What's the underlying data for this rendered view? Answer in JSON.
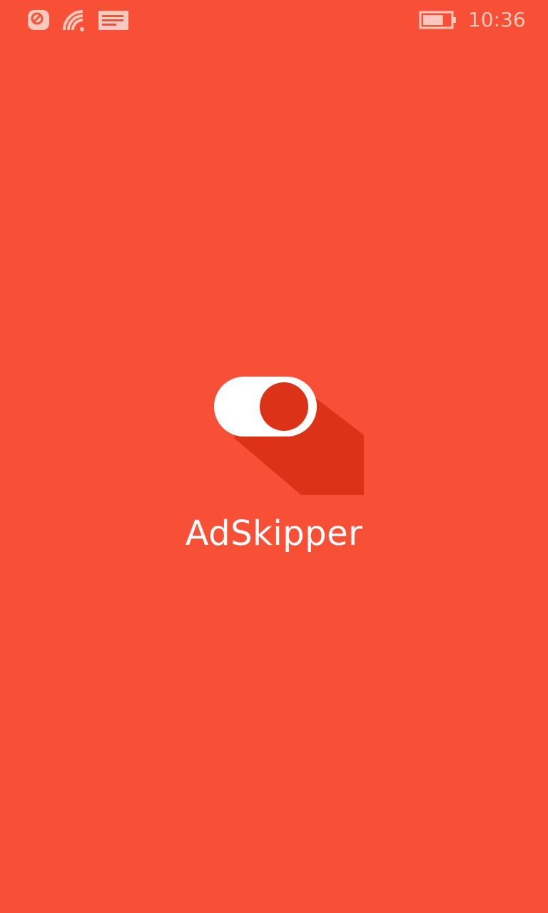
{
  "status_bar": {
    "time": "10:36",
    "icons": [
      "sync-icon",
      "wifi-icon",
      "message-icon",
      "battery-icon"
    ],
    "battery_level": 0.75
  },
  "splash": {
    "app_name": "AdSkipper",
    "logo_icon": "toggle-switch-icon"
  },
  "colors": {
    "background": "#f75036",
    "logo_shadow": "#dc3318",
    "toggle_knob": "#dc3318",
    "toggle_track": "#ffffff",
    "status_text": "#f9c9bd"
  }
}
